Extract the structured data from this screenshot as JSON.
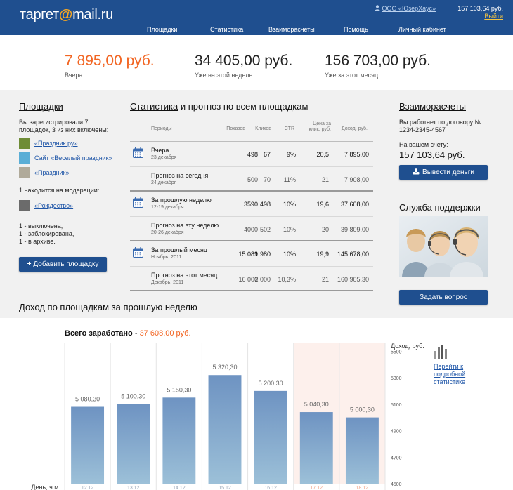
{
  "header": {
    "logo_prefix": "таргет",
    "logo_at": "@",
    "logo_suffix": "mail.ru",
    "nav": [
      "Площадки",
      "Статистика",
      "Взаиморасчеты",
      "Помощь",
      "Личный кабинет"
    ],
    "company": "ООО «ЮзерХаус»",
    "balance": "157 103,64 руб.",
    "logout": "Выйти"
  },
  "summary": [
    {
      "value": "7 895,00 руб.",
      "label": "Вчера",
      "accent": true
    },
    {
      "value": "34 405,00 руб.",
      "label": "Уже на этой неделе",
      "accent": false
    },
    {
      "value": "156 703,00 руб.",
      "label": "Уже за этот месяц",
      "accent": false
    }
  ],
  "sites": {
    "title": "Площадки",
    "registered_text": "Вы зарегистрировали 7 площадок, 3 из них включены:",
    "items": [
      {
        "name": "«Праздник.ру»",
        "color": "#6e8c36"
      },
      {
        "name": "Сайт «Веселый праздник»",
        "color": "#5aaed6"
      },
      {
        "name": "«Праздник»",
        "color": "#b0aa9a"
      }
    ],
    "moderation_text": "1 находится на модерации:",
    "moderation_items": [
      {
        "name": "«Рождество»",
        "color": "#6b6b6b"
      }
    ],
    "status_lines": [
      "1 - выключена,",
      "1 - заблокирована,",
      "1 - в архиве."
    ],
    "add_button": "Добавить площадку"
  },
  "stats": {
    "title_link": "Статистика",
    "title_rest": " и прогноз по всем площадкам",
    "headers": {
      "period": "Периоды",
      "shows": "Показов",
      "clicks": "Кликов",
      "ctr": "CTR",
      "price": "Цена за клик, руб.",
      "income": "Доход, руб."
    },
    "rows": [
      {
        "name": "Вчера",
        "date": "23 декабря",
        "shows": "498",
        "clicks": "67",
        "ctr": "9%",
        "price": "20,5",
        "income": "7 895,00",
        "forecast": false,
        "group_end": false
      },
      {
        "name": "Прогноз на сегодня",
        "date": "24 декабря",
        "shows": "500",
        "clicks": "70",
        "ctr": "11%",
        "price": "21",
        "income": "7 908,00",
        "forecast": true,
        "group_end": true
      },
      {
        "name": "За прошлую неделю",
        "date": "12-19 декабря",
        "shows": "3590",
        "clicks": "498",
        "ctr": "10%",
        "price": "19,6",
        "income": "37 608,00",
        "forecast": false,
        "group_end": false
      },
      {
        "name": "Прогноз на эту неделю",
        "date": "20-26 декабря",
        "shows": "4000",
        "clicks": "502",
        "ctr": "10%",
        "price": "20",
        "income": "39 809,00",
        "forecast": true,
        "group_end": true
      },
      {
        "name": "За прошлый месяц",
        "date": "Ноябрь, 2011",
        "shows": "15 089",
        "clicks": "1 980",
        "ctr": "10%",
        "price": "19,9",
        "income": "145 678,00",
        "forecast": false,
        "group_end": false
      },
      {
        "name": "Прогноз на этот месяц",
        "date": "Декабрь, 2011",
        "shows": "16 000",
        "clicks": "2 000",
        "ctr": "10,3%",
        "price": "21",
        "income": "160 905,30",
        "forecast": true,
        "group_end": true
      }
    ]
  },
  "settlements": {
    "title": "Взаиморасчеты",
    "contract_text": "Вы работает по договору № 1234-2345-4567",
    "balance_label": "На вашем счету:",
    "balance": "157 103,64 руб.",
    "withdraw_button": "Вывести деньги"
  },
  "support": {
    "title": "Служба поддержки",
    "ask_button": "Задать вопрос"
  },
  "income_title": "Доход по площадкам за прошлую неделю",
  "chart_data": {
    "type": "bar",
    "title_bold": "Всего заработано",
    "title_sep": " - ",
    "title_amount": "37 608,00 руб.",
    "ylabel": "Доход, руб.",
    "xlabel": "День, ч.м.",
    "categories": [
      "12.12",
      "13.12",
      "14.12",
      "15.12",
      "16.12",
      "17.12",
      "18.12"
    ],
    "weekend": [
      false,
      false,
      false,
      false,
      false,
      true,
      true
    ],
    "values": [
      5080.3,
      5100.3,
      5150.3,
      5320.3,
      5200.3,
      5040.3,
      5000.3
    ],
    "value_labels": [
      "5 080,30",
      "5 100,30",
      "5 150,30",
      "5 320,30",
      "5 200,30",
      "5 040,30",
      "5 000,30"
    ],
    "yticks": [
      4500,
      4700,
      4900,
      5100,
      5300,
      5500
    ],
    "ylim": [
      4500,
      5560
    ],
    "bar_color": "#6e93c2",
    "weekend_bg": "#fdf0ec",
    "weekday_label_color": "#9aa7b8",
    "weekend_label_color": "#f0a58a"
  },
  "detail_link": "Перейти к подробной статистике"
}
